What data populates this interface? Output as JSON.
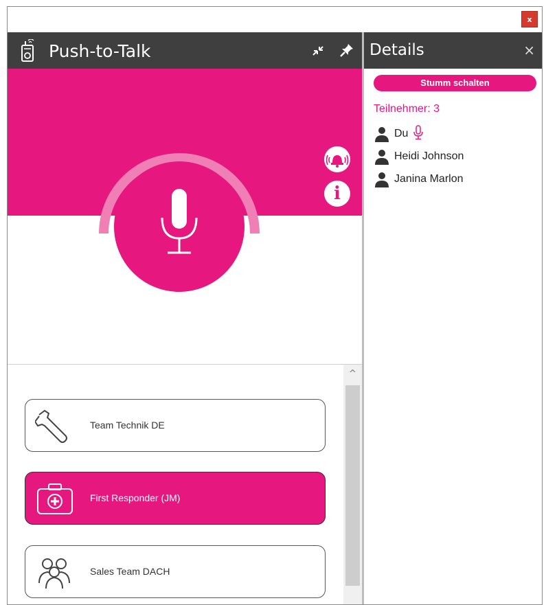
{
  "window": {
    "close_label": "x"
  },
  "ptt": {
    "title": "Push-to-Talk",
    "icons": {
      "app": "walkie-talkie-icon",
      "minimize": "collapse-arrows-icon",
      "pin": "pin-icon",
      "mic": "microphone-icon",
      "alarm": "alarm-bell-icon",
      "info": "info-icon"
    },
    "info_glyph": "i"
  },
  "groups": [
    {
      "label": "Team Technik DE",
      "icon": "wrench-icon",
      "active": false
    },
    {
      "label": "First Responder (JM)",
      "icon": "first-aid-kit-icon",
      "active": true
    },
    {
      "label": "Sales Team DACH",
      "icon": "people-group-icon",
      "active": false
    }
  ],
  "scrollbar": {
    "up_glyph": "^"
  },
  "details": {
    "title": "Details",
    "close_glyph": "×",
    "mute_label": "Stumm schalten",
    "participants_label": "Teilnehmer: 3",
    "participants": [
      {
        "name": "Du",
        "speaking": true
      },
      {
        "name": "Heidi Johnson",
        "speaking": false
      },
      {
        "name": "Janina Marlon",
        "speaking": false
      }
    ]
  },
  "colors": {
    "accent": "#e6177e",
    "header": "#3f3f3f",
    "close_red": "#d43b2e"
  }
}
